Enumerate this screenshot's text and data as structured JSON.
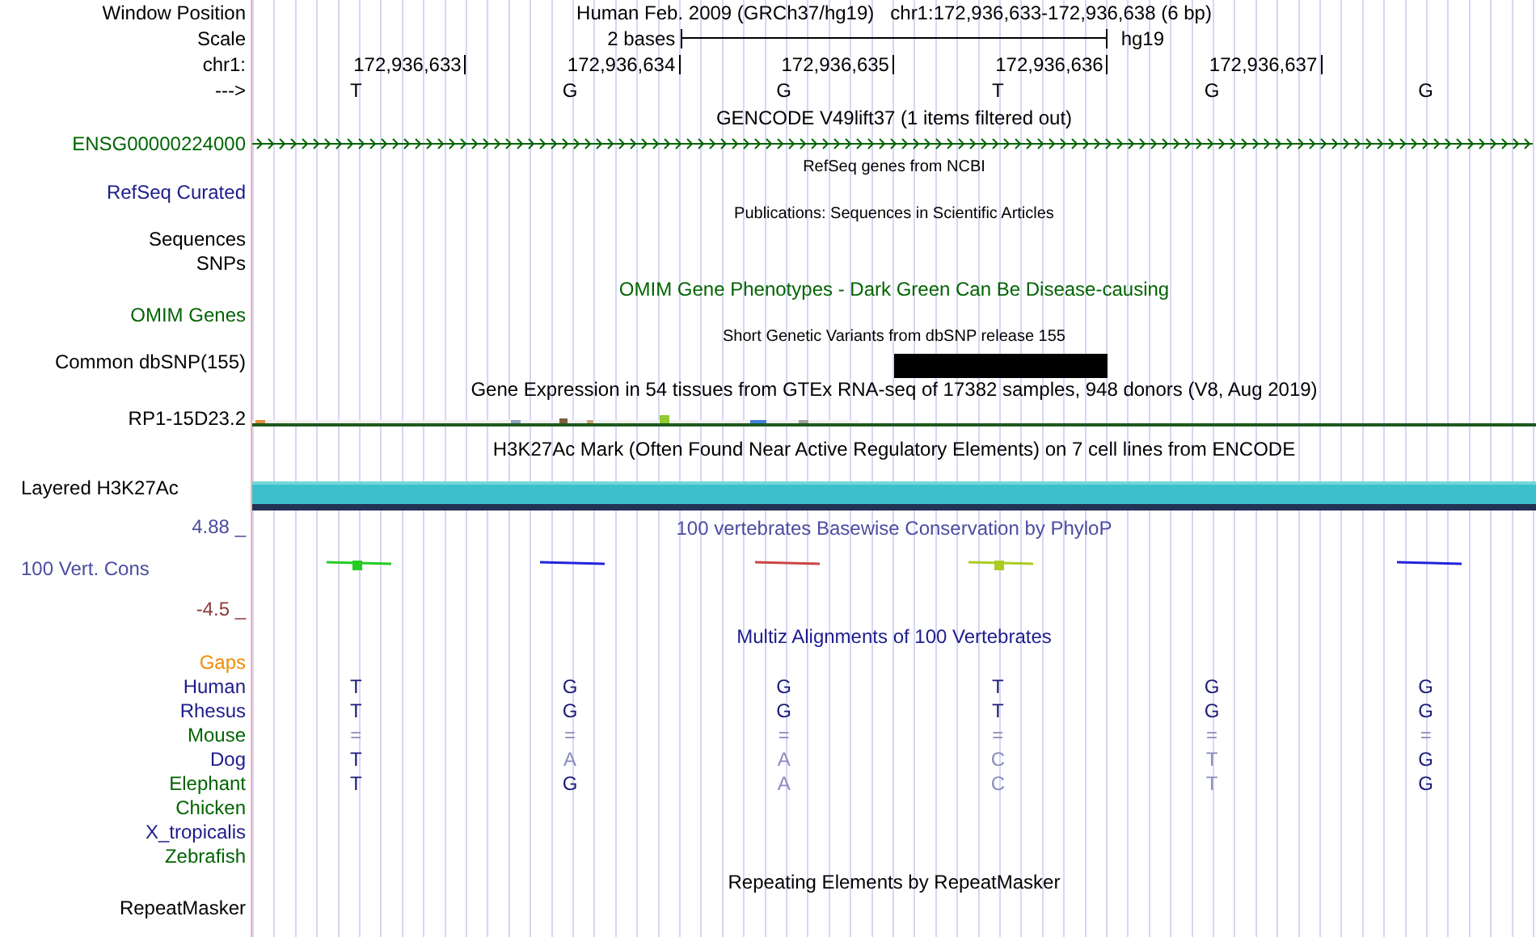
{
  "header": {
    "label": "Window Position",
    "title": "Human Feb. 2009 (GRCh37/hg19)",
    "position": "chr1:172,936,633-172,936,638 (6 bp)"
  },
  "scale": {
    "label": "Scale",
    "length": "2 bases",
    "assembly": "hg19"
  },
  "ruler": {
    "label": "chr1:",
    "ticks": [
      "172,936,633",
      "172,936,634",
      "172,936,635",
      "172,936,636",
      "172,936,637"
    ]
  },
  "sequence": {
    "label": "--->",
    "bases": [
      "T",
      "G",
      "G",
      "T",
      "G",
      "G"
    ]
  },
  "tracks": [
    {
      "kind": "title",
      "text": "GENCODE V49lift37 (1 items filtered out)",
      "color": "#000000"
    },
    {
      "kind": "gene",
      "label": "ENSG00000224000",
      "color": "#006400"
    },
    {
      "kind": "small_title",
      "text": "RefSeq genes from NCBI"
    },
    {
      "kind": "label",
      "label": "RefSeq Curated",
      "color": "#1c1c8c"
    },
    {
      "kind": "small_title",
      "text": "Publications: Sequences in Scientific Articles"
    },
    {
      "kind": "label",
      "label": "Sequences",
      "color": "#000000"
    },
    {
      "kind": "label",
      "label": "SNPs",
      "color": "#000000"
    },
    {
      "kind": "title",
      "text": "OMIM Gene Phenotypes - Dark Green Can Be Disease-causing",
      "color": "#006400"
    },
    {
      "kind": "label",
      "label": "OMIM Genes",
      "color": "#006400"
    },
    {
      "kind": "small_title",
      "text": "Short Genetic Variants from dbSNP release 155"
    },
    {
      "kind": "variants",
      "label": "Common dbSNP(155)",
      "color": "#000000"
    },
    {
      "kind": "title",
      "text": "Gene Expression in 54 tissues from GTEx RNA-seq of 17382 samples, 948 donors (V8, Aug 2019)",
      "color": "#000000"
    },
    {
      "kind": "expression",
      "label": "RP1-15D23.2",
      "color": "#000000"
    },
    {
      "kind": "title",
      "text": "H3K27Ac Mark (Often Found Near Active Regulatory Elements) on 7 cell lines from ENCODE",
      "color": "#000000"
    },
    {
      "kind": "signal",
      "label": "Layered H3K27Ac",
      "color": "#000000"
    },
    {
      "kind": "conservation",
      "max": "4.88 _",
      "label": "100 Vert. Cons",
      "min": "-4.5 _",
      "title": "100 vertebrates Basewise Conservation by PhyloP",
      "color": "#4c4ca0"
    },
    {
      "kind": "title",
      "text": "Multiz Alignments of 100 Vertebrates",
      "color": "#1c1c8c"
    },
    {
      "kind": "species",
      "label": "Gaps",
      "color": "#f08c00"
    },
    {
      "kind": "species",
      "label": "Human",
      "color": "#1c1c8c",
      "bases": [
        {
          "text": "T",
          "matches": true
        },
        {
          "text": "G",
          "matches": true
        },
        {
          "text": "G",
          "matches": true
        },
        {
          "text": "T",
          "matches": true
        },
        {
          "text": "G",
          "matches": true
        },
        {
          "text": "G",
          "matches": true
        }
      ]
    },
    {
      "kind": "species",
      "label": "Rhesus",
      "color": "#1c1c8c",
      "bases": [
        {
          "text": "T",
          "matches": true
        },
        {
          "text": "G",
          "matches": true
        },
        {
          "text": "G",
          "matches": true
        },
        {
          "text": "T",
          "matches": true
        },
        {
          "text": "G",
          "matches": true
        },
        {
          "text": "G",
          "matches": true
        }
      ]
    },
    {
      "kind": "species",
      "label": "Mouse",
      "color": "#006400",
      "bases": [
        {
          "text": "=",
          "matches": false
        },
        {
          "text": "=",
          "matches": false
        },
        {
          "text": "=",
          "matches": false
        },
        {
          "text": "=",
          "matches": false
        },
        {
          "text": "=",
          "matches": false
        },
        {
          "text": "=",
          "matches": false
        }
      ]
    },
    {
      "kind": "species",
      "label": "Dog",
      "color": "#1c1c8c",
      "bases": [
        {
          "text": "T",
          "matches": true
        },
        {
          "text": "A",
          "matches": false
        },
        {
          "text": "A",
          "matches": false
        },
        {
          "text": "C",
          "matches": false
        },
        {
          "text": "T",
          "matches": false
        },
        {
          "text": "G",
          "matches": true
        }
      ]
    },
    {
      "kind": "species",
      "label": "Elephant",
      "color": "#006400",
      "bases": [
        {
          "text": "T",
          "matches": true
        },
        {
          "text": "G",
          "matches": true
        },
        {
          "text": "A",
          "matches": false
        },
        {
          "text": "C",
          "matches": false
        },
        {
          "text": "T",
          "matches": false
        },
        {
          "text": "G",
          "matches": true
        }
      ]
    },
    {
      "kind": "species",
      "label": "Chicken",
      "color": "#006400"
    },
    {
      "kind": "species",
      "label": "X_tropicalis",
      "color": "#1c1c8c"
    },
    {
      "kind": "species",
      "label": "Zebrafish",
      "color": "#006400"
    },
    {
      "kind": "title",
      "text": "Repeating Elements by RepeatMasker",
      "color": "#000000"
    },
    {
      "kind": "label",
      "label": "RepeatMasker",
      "color": "#000000"
    }
  ]
}
